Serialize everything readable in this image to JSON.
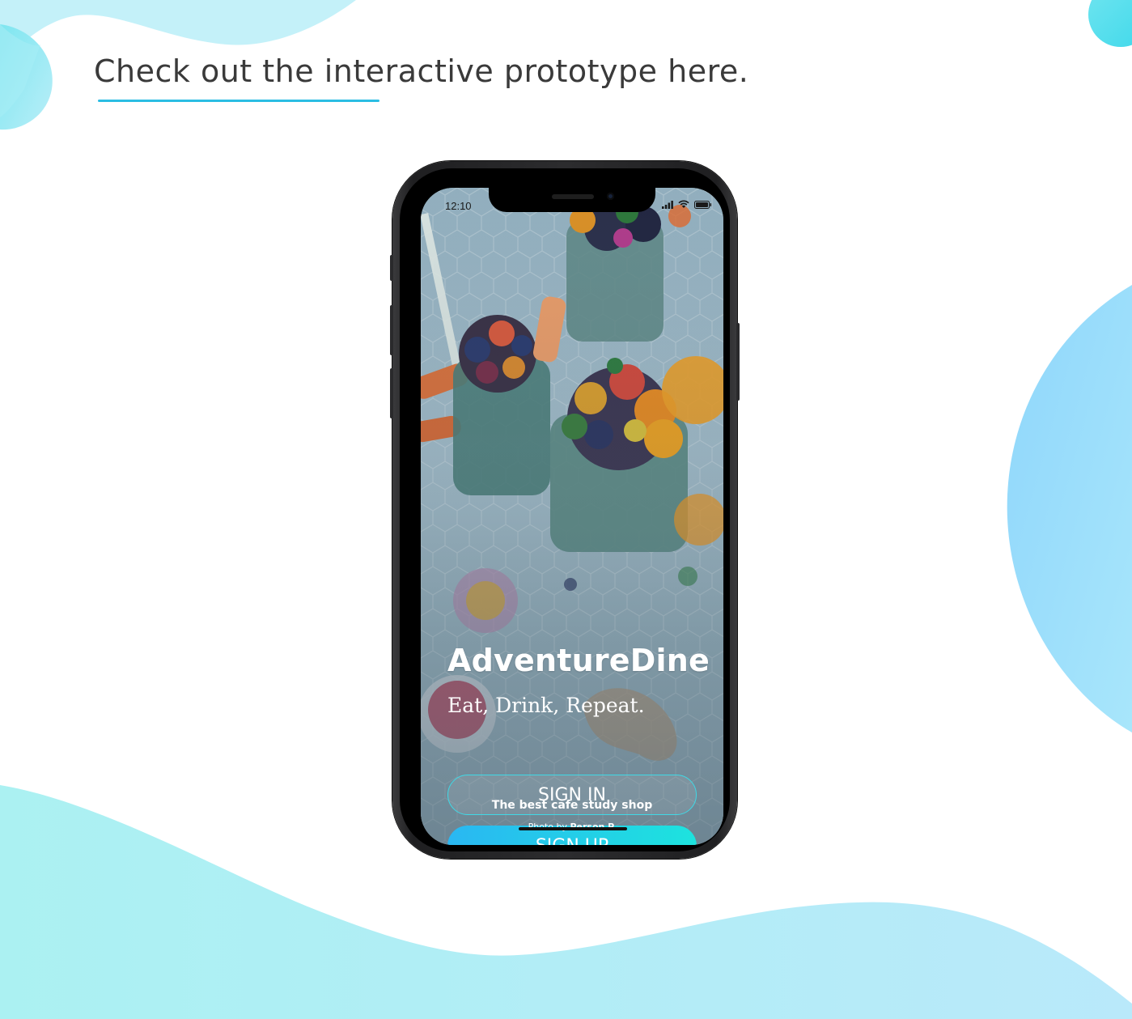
{
  "header": {
    "title": "Check out the interactive prototype here."
  },
  "phone": {
    "status_bar": {
      "time": "12:10",
      "icons": [
        "signal-icon",
        "wifi-icon",
        "battery-icon"
      ]
    },
    "app": {
      "name": "AdventureDine",
      "tagline": "Eat, Drink, Repeat.",
      "sign_in_label": "SIGN IN",
      "sign_up_label": "SIGN UP",
      "footer_tagline": "The best cafe study shop",
      "photo_credit_prefix": "Photo by",
      "photo_credit_name": "Person P."
    }
  },
  "colors": {
    "accent": "#2bbde3",
    "button_gradient_start": "#2ab7f2",
    "button_gradient_end": "#1de3de",
    "sign_in_border": "#3fd9e6",
    "title_text": "#3a3a3a"
  }
}
